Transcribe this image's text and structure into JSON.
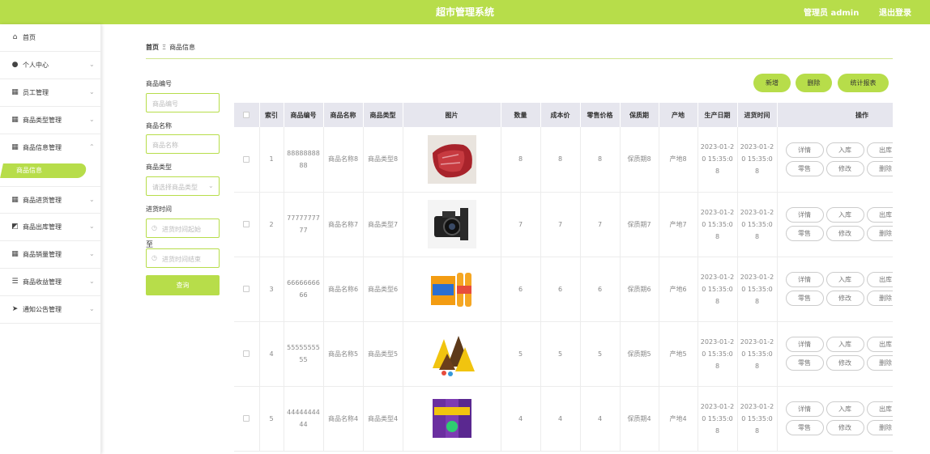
{
  "app": {
    "title": "超市管理系统",
    "admin_label": "管理员 admin",
    "logout_label": "退出登录"
  },
  "sidebar": {
    "items": [
      {
        "label": "首页",
        "icon": "home-icon",
        "has_arrow": false
      },
      {
        "label": "个人中心",
        "icon": "user-icon",
        "has_arrow": true
      },
      {
        "label": "员工管理",
        "icon": "grid-icon",
        "has_arrow": true
      },
      {
        "label": "商品类型管理",
        "icon": "grid-icon",
        "has_arrow": true
      },
      {
        "label": "商品信息管理",
        "icon": "grid-icon",
        "has_arrow": true,
        "expanded": true
      },
      {
        "label": "商品进货管理",
        "icon": "grid-icon",
        "has_arrow": true
      },
      {
        "label": "商品出库管理",
        "icon": "chart-icon",
        "has_arrow": true
      },
      {
        "label": "商品销量管理",
        "icon": "grid-icon",
        "has_arrow": true
      },
      {
        "label": "商品收益管理",
        "icon": "list-icon",
        "has_arrow": true
      },
      {
        "label": "通知公告管理",
        "icon": "send-icon",
        "has_arrow": true
      }
    ],
    "active_sub": "商品信息"
  },
  "breadcrumb": {
    "home": "首页",
    "separator": "Ξ",
    "current": "商品信息"
  },
  "search": {
    "code_label": "商品编号",
    "code_placeholder": "商品编号",
    "name_label": "商品名称",
    "name_placeholder": "商品名称",
    "type_label": "商品类型",
    "type_placeholder": "请选择商品类型",
    "time_label": "进货时间",
    "time_start_placeholder": "进货时间起始",
    "to_label": "至",
    "time_end_placeholder": "进货时间结束",
    "search_button": "查询"
  },
  "toolbar": {
    "add": "新增",
    "delete": "删除",
    "stats": "统计报表"
  },
  "table": {
    "headers": [
      "索引",
      "商品编号",
      "商品名称",
      "商品类型",
      "图片",
      "数量",
      "成本价",
      "零售价格",
      "保质期",
      "产地",
      "生产日期",
      "进货时间",
      "操作"
    ],
    "op_buttons": [
      "详情",
      "入库",
      "出库",
      "零售",
      "修改",
      "删除"
    ],
    "rows": [
      {
        "index": "1",
        "code": "8888888888",
        "name": "商品名称8",
        "type": "商品类型8",
        "image": "meat",
        "qty": "8",
        "cost": "8",
        "retail": "8",
        "shelf": "保质期8",
        "origin": "产地8",
        "made": "2023-01-20 15:35:08",
        "stock": "2023-01-20 15:35:08"
      },
      {
        "index": "2",
        "code": "7777777777",
        "name": "商品名称7",
        "type": "商品类型7",
        "image": "camera",
        "qty": "7",
        "cost": "7",
        "retail": "7",
        "shelf": "保质期7",
        "origin": "产地7",
        "made": "2023-01-20 15:35:08",
        "stock": "2023-01-20 15:35:08"
      },
      {
        "index": "3",
        "code": "6666666666",
        "name": "商品名称6",
        "type": "商品类型6",
        "image": "drinks",
        "qty": "6",
        "cost": "6",
        "retail": "6",
        "shelf": "保质期6",
        "origin": "产地6",
        "made": "2023-01-20 15:35:08",
        "stock": "2023-01-20 15:35:08"
      },
      {
        "index": "4",
        "code": "5555555555",
        "name": "商品名称5",
        "type": "商品类型5",
        "image": "chocolate",
        "qty": "5",
        "cost": "5",
        "retail": "5",
        "shelf": "保质期5",
        "origin": "产地5",
        "made": "2023-01-20 15:35:08",
        "stock": "2023-01-20 15:35:08"
      },
      {
        "index": "5",
        "code": "4444444444",
        "name": "商品名称4",
        "type": "商品类型4",
        "image": "snack-boxes",
        "qty": "4",
        "cost": "4",
        "retail": "4",
        "shelf": "保质期4",
        "origin": "产地4",
        "made": "2023-01-20 15:35:08",
        "stock": "2023-01-20 15:35:08"
      }
    ]
  },
  "colors": {
    "accent": "#b7dd4a",
    "header_bg": "#e6e6ee"
  }
}
